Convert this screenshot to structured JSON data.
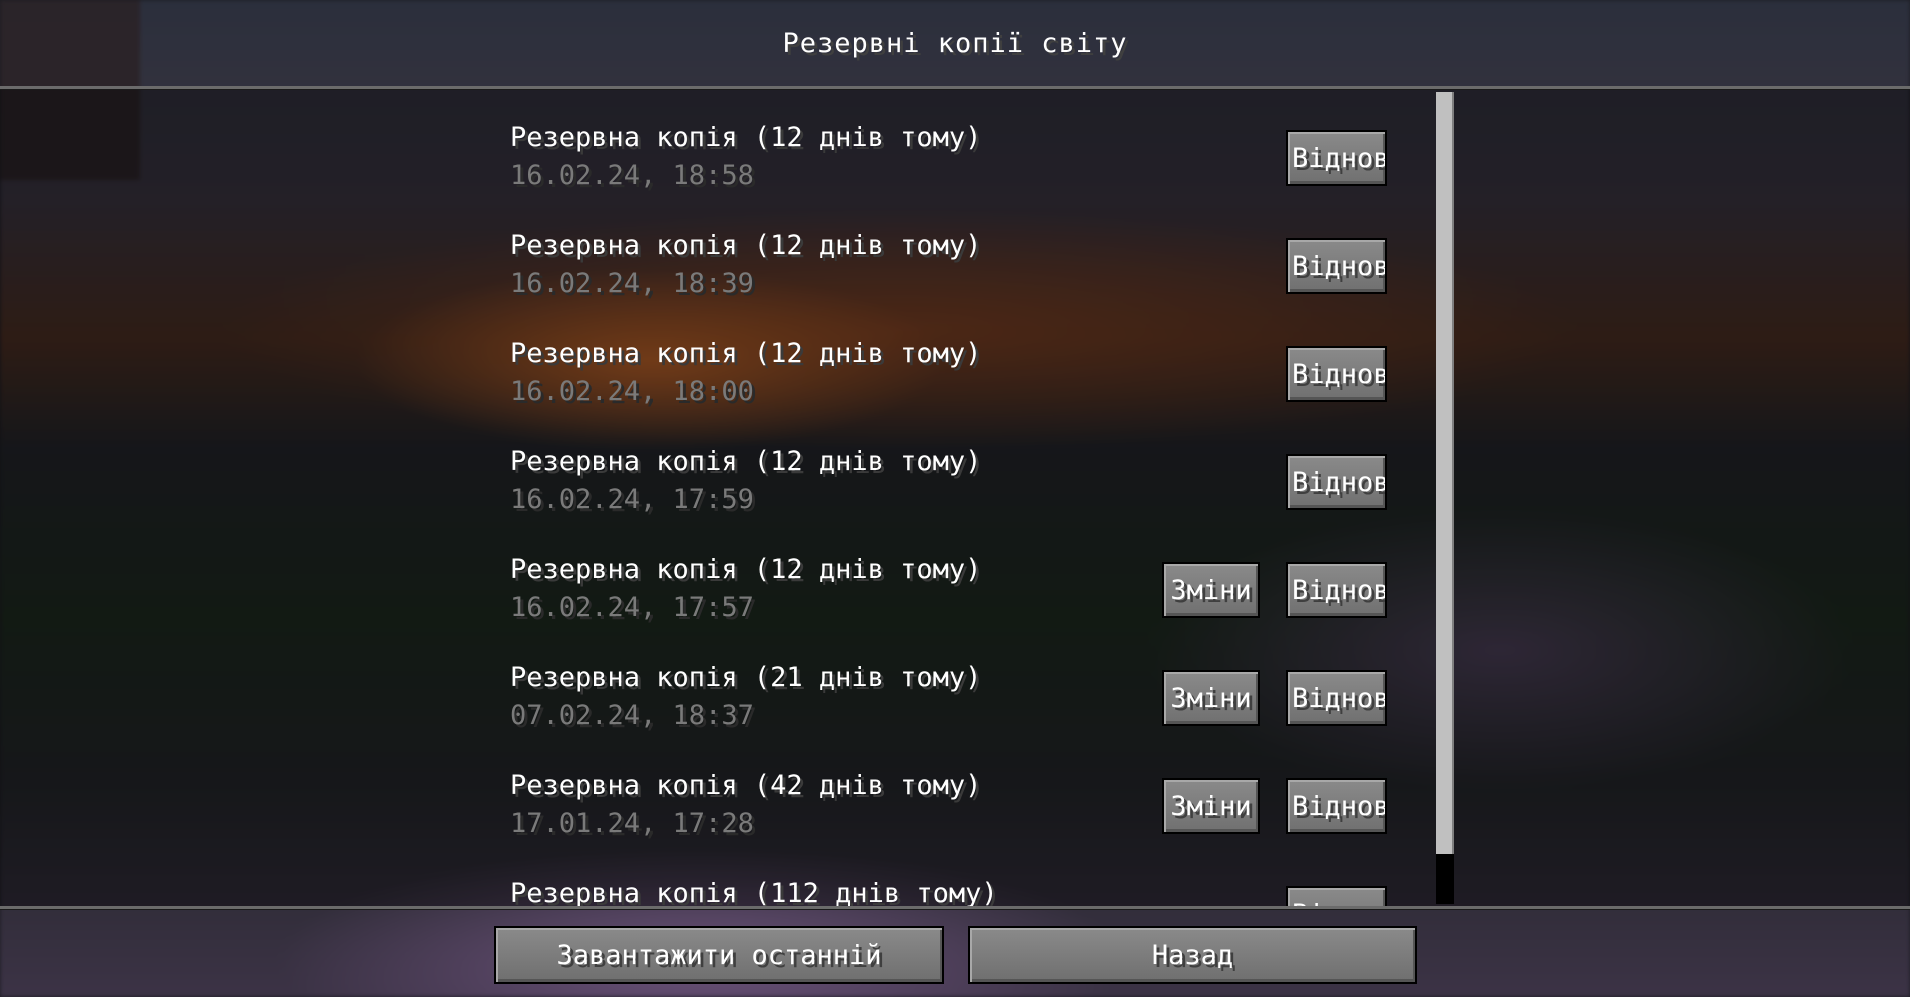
{
  "screen": {
    "title": "Резервні копії світу"
  },
  "backups": [
    {
      "title": "Резервна копія (12 днів тому)",
      "date": "16.02.24, 18:58",
      "restore_label": "Віднови",
      "changes_label": ""
    },
    {
      "title": "Резервна копія (12 днів тому)",
      "date": "16.02.24, 18:39",
      "restore_label": "Віднови",
      "changes_label": ""
    },
    {
      "title": "Резервна копія (12 днів тому)",
      "date": "16.02.24, 18:00",
      "restore_label": "Віднови",
      "changes_label": ""
    },
    {
      "title": "Резервна копія (12 днів тому)",
      "date": "16.02.24, 17:59",
      "restore_label": "Віднови",
      "changes_label": ""
    },
    {
      "title": "Резервна копія (12 днів тому)",
      "date": "16.02.24, 17:57",
      "restore_label": "Віднови",
      "changes_label": "Зміни"
    },
    {
      "title": "Резервна копія (21 днів тому)",
      "date": "07.02.24, 18:37",
      "restore_label": "Віднови",
      "changes_label": "Зміни"
    },
    {
      "title": "Резервна копія (42 днів тому)",
      "date": "17.01.24, 17:28",
      "restore_label": "Віднови",
      "changes_label": "Зміни"
    },
    {
      "title": "Резервна копія (112 днів тому)",
      "date": "",
      "restore_label": "Віднови",
      "changes_label": ""
    }
  ],
  "footer": {
    "load_latest_label": "Завантажити останній",
    "back_label": "Назад"
  },
  "colors": {
    "date_text": "#7a7a7a",
    "button": "#7a7a7a",
    "scrollbar_thumb": "#c0c0c0"
  }
}
